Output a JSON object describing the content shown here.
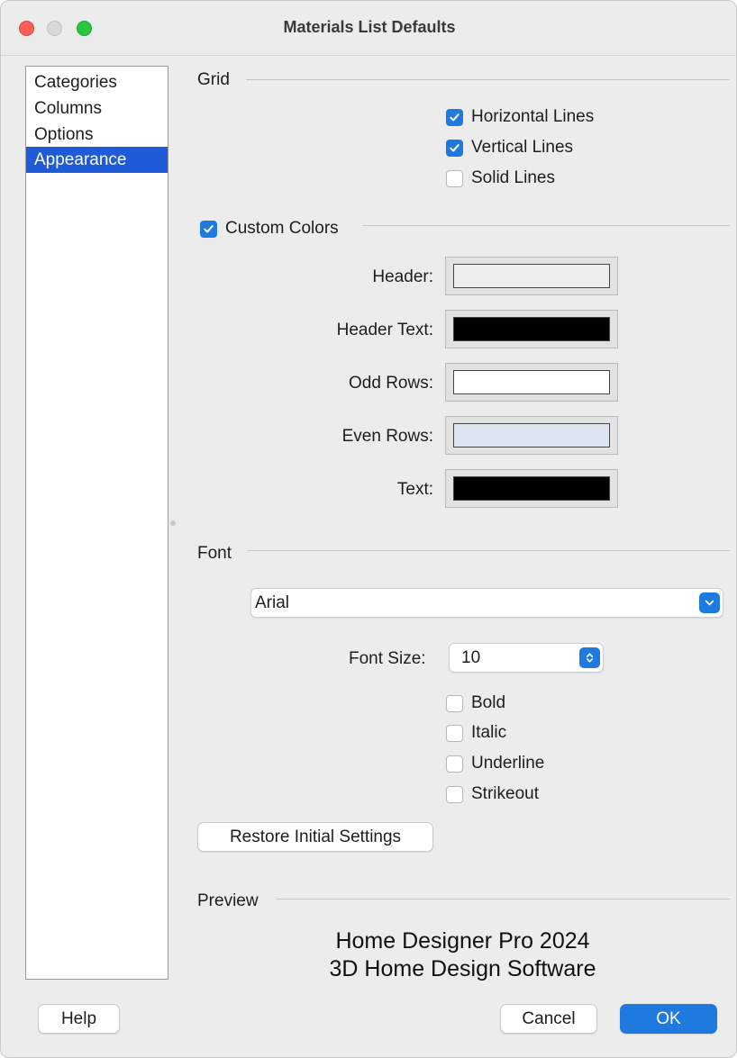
{
  "window": {
    "title": "Materials List Defaults"
  },
  "sidebar": {
    "items": [
      {
        "label": "Categories",
        "selected": false
      },
      {
        "label": "Columns",
        "selected": false
      },
      {
        "label": "Options",
        "selected": false
      },
      {
        "label": "Appearance",
        "selected": true
      }
    ]
  },
  "grid": {
    "label": "Grid",
    "options": [
      {
        "label": "Horizontal Lines",
        "checked": true
      },
      {
        "label": "Vertical Lines",
        "checked": true
      },
      {
        "label": "Solid Lines",
        "checked": false
      }
    ]
  },
  "custom_colors": {
    "label": "Custom Colors",
    "checked": true,
    "rows": [
      {
        "label": "Header:",
        "color": "#eeeeee"
      },
      {
        "label": "Header Text:",
        "color": "#000000"
      },
      {
        "label": "Odd Rows:",
        "color": "#ffffff"
      },
      {
        "label": "Even Rows:",
        "color": "#dde6f0"
      },
      {
        "label": "Text:",
        "color": "#000000"
      }
    ]
  },
  "font": {
    "label": "Font",
    "family": "Arial",
    "size_label": "Font Size:",
    "size": "10",
    "styles": [
      {
        "label": "Bold",
        "checked": false
      },
      {
        "label": "Italic",
        "checked": false
      },
      {
        "label": "Underline",
        "checked": false
      },
      {
        "label": "Strikeout",
        "checked": false
      }
    ]
  },
  "restore_button": "Restore Initial Settings",
  "preview": {
    "label": "Preview",
    "line1": "Home Designer Pro 2024",
    "line2": "3D Home Design Software"
  },
  "footer": {
    "help": "Help",
    "cancel": "Cancel",
    "ok": "OK"
  },
  "colors": {
    "accent": "#1f7ae0",
    "selection": "#1f5bd8"
  }
}
